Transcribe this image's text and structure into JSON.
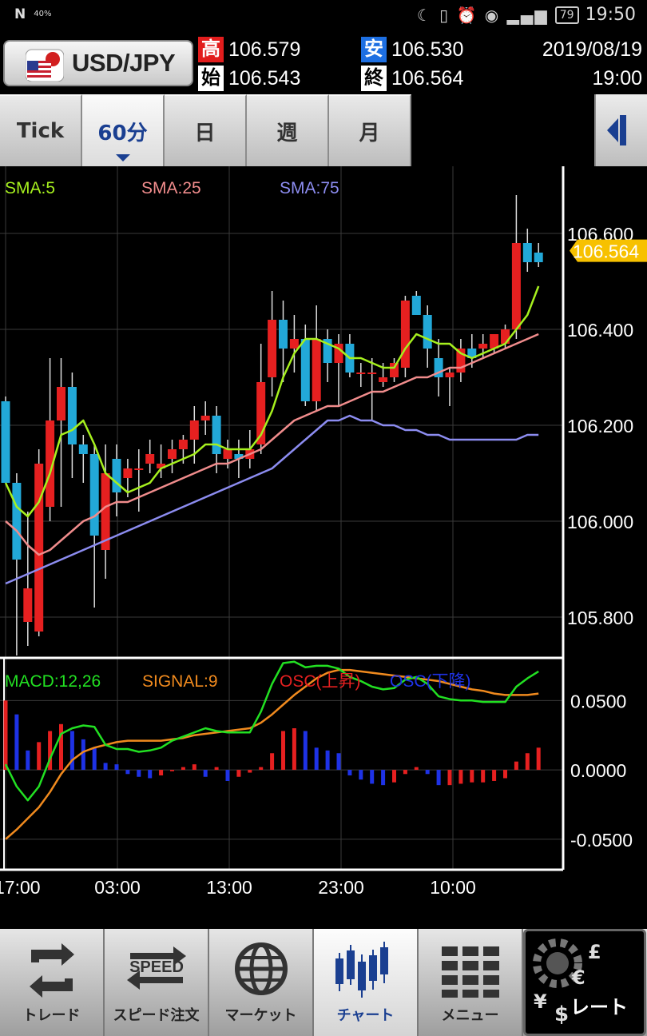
{
  "status_bar": {
    "nfc": "N",
    "signal_pct": "40%",
    "icons": "☾ ▯ ⏰ ◉ ▂▄▆",
    "battery": "79",
    "time": "19:50"
  },
  "header": {
    "pair": "USD/JPY",
    "high_badge": "高",
    "high_value": "106.579",
    "low_badge": "安",
    "low_value": "106.530",
    "open_badge": "始",
    "open_value": "106.543",
    "close_badge": "終",
    "close_value": "106.564",
    "date": "2019/08/19",
    "time": "19:00"
  },
  "tabs": [
    {
      "label": "Tick",
      "active": false
    },
    {
      "label": "60分",
      "active": true
    },
    {
      "label": "日",
      "active": false
    },
    {
      "label": "週",
      "active": false
    },
    {
      "label": "月",
      "active": false
    }
  ],
  "colors": {
    "up": "#e62020",
    "down": "#22a8d8",
    "sma5": "#a6f01e",
    "sma25": "#f08c8c",
    "sma75": "#8c8cf0",
    "macd": "#22e022",
    "signal": "#f08a1e",
    "osc_up": "#e62020",
    "osc_down": "#1e32e6",
    "current_price": "#f7c100"
  },
  "chart_data": [
    {
      "type": "candlestick",
      "legend": [
        "SMA:5",
        "SMA:25",
        "SMA:75"
      ],
      "y_ticks": [
        "106.600",
        "106.400",
        "106.200",
        "106.000",
        "105.800"
      ],
      "ylim": [
        105.72,
        106.74
      ],
      "current_price": "106.564",
      "candles": [
        {
          "o": 106.25,
          "h": 106.26,
          "l": 106.12,
          "c": 106.08
        },
        {
          "o": 106.08,
          "h": 106.1,
          "l": 105.72,
          "c": 105.92
        },
        {
          "o": 105.79,
          "h": 106.02,
          "l": 105.74,
          "c": 105.86
        },
        {
          "o": 105.77,
          "h": 106.15,
          "l": 105.76,
          "c": 106.12
        },
        {
          "o": 106.03,
          "h": 106.34,
          "l": 106.0,
          "c": 106.21
        },
        {
          "o": 106.21,
          "h": 106.34,
          "l": 106.03,
          "c": 106.28
        },
        {
          "o": 106.28,
          "h": 106.31,
          "l": 106.09,
          "c": 106.16
        },
        {
          "o": 106.16,
          "h": 106.18,
          "l": 106.08,
          "c": 106.14
        },
        {
          "o": 106.14,
          "h": 106.16,
          "l": 105.82,
          "c": 105.97
        },
        {
          "o": 105.94,
          "h": 106.16,
          "l": 105.88,
          "c": 106.1
        },
        {
          "o": 106.13,
          "h": 106.16,
          "l": 106.01,
          "c": 106.06
        },
        {
          "o": 106.09,
          "h": 106.13,
          "l": 106.05,
          "c": 106.11
        },
        {
          "o": 106.11,
          "h": 106.15,
          "l": 106.02,
          "c": 106.11
        },
        {
          "o": 106.12,
          "h": 106.17,
          "l": 106.1,
          "c": 106.14
        },
        {
          "o": 106.11,
          "h": 106.16,
          "l": 106.09,
          "c": 106.12
        },
        {
          "o": 106.13,
          "h": 106.17,
          "l": 106.1,
          "c": 106.15
        },
        {
          "o": 106.15,
          "h": 106.18,
          "l": 106.12,
          "c": 106.17
        },
        {
          "o": 106.17,
          "h": 106.24,
          "l": 106.12,
          "c": 106.21
        },
        {
          "o": 106.21,
          "h": 106.25,
          "l": 106.18,
          "c": 106.22
        },
        {
          "o": 106.22,
          "h": 106.24,
          "l": 106.1,
          "c": 106.14
        },
        {
          "o": 106.13,
          "h": 106.17,
          "l": 106.11,
          "c": 106.15
        },
        {
          "o": 106.14,
          "h": 106.17,
          "l": 106.09,
          "c": 106.13
        },
        {
          "o": 106.13,
          "h": 106.19,
          "l": 106.11,
          "c": 106.15
        },
        {
          "o": 106.16,
          "h": 106.37,
          "l": 106.14,
          "c": 106.29
        },
        {
          "o": 106.3,
          "h": 106.48,
          "l": 106.26,
          "c": 106.42
        },
        {
          "o": 106.42,
          "h": 106.46,
          "l": 106.29,
          "c": 106.36
        },
        {
          "o": 106.36,
          "h": 106.43,
          "l": 106.31,
          "c": 106.38
        },
        {
          "o": 106.38,
          "h": 106.41,
          "l": 106.24,
          "c": 106.25
        },
        {
          "o": 106.25,
          "h": 106.45,
          "l": 106.23,
          "c": 106.38
        },
        {
          "o": 106.38,
          "h": 106.4,
          "l": 106.29,
          "c": 106.33
        },
        {
          "o": 106.33,
          "h": 106.39,
          "l": 106.24,
          "c": 106.37
        },
        {
          "o": 106.37,
          "h": 106.39,
          "l": 106.3,
          "c": 106.31
        },
        {
          "o": 106.31,
          "h": 106.33,
          "l": 106.28,
          "c": 106.31
        },
        {
          "o": 106.31,
          "h": 106.34,
          "l": 106.21,
          "c": 106.31
        },
        {
          "o": 106.29,
          "h": 106.33,
          "l": 106.28,
          "c": 106.3
        },
        {
          "o": 106.3,
          "h": 106.34,
          "l": 106.29,
          "c": 106.33
        },
        {
          "o": 106.32,
          "h": 106.47,
          "l": 106.3,
          "c": 106.46
        },
        {
          "o": 106.47,
          "h": 106.48,
          "l": 106.43,
          "c": 106.43
        },
        {
          "o": 106.43,
          "h": 106.45,
          "l": 106.32,
          "c": 106.36
        },
        {
          "o": 106.34,
          "h": 106.38,
          "l": 106.26,
          "c": 106.3
        },
        {
          "o": 106.3,
          "h": 106.32,
          "l": 106.24,
          "c": 106.31
        },
        {
          "o": 106.31,
          "h": 106.38,
          "l": 106.29,
          "c": 106.36
        },
        {
          "o": 106.36,
          "h": 106.39,
          "l": 106.32,
          "c": 106.34
        },
        {
          "o": 106.36,
          "h": 106.39,
          "l": 106.34,
          "c": 106.37
        },
        {
          "o": 106.36,
          "h": 106.39,
          "l": 106.35,
          "c": 106.39
        },
        {
          "o": 106.37,
          "h": 106.41,
          "l": 106.36,
          "c": 106.4
        },
        {
          "o": 106.4,
          "h": 106.68,
          "l": 106.38,
          "c": 106.58
        },
        {
          "o": 106.58,
          "h": 106.61,
          "l": 106.52,
          "c": 106.54
        },
        {
          "o": 106.56,
          "h": 106.58,
          "l": 106.53,
          "c": 106.54
        }
      ],
      "sma5": [
        106.08,
        106.03,
        106.01,
        106.04,
        106.1,
        106.18,
        106.19,
        106.21,
        106.16,
        106.1,
        106.08,
        106.06,
        106.07,
        106.08,
        106.11,
        106.12,
        106.13,
        106.14,
        106.16,
        106.16,
        106.15,
        106.15,
        106.15,
        106.18,
        106.23,
        106.3,
        106.35,
        106.38,
        106.38,
        106.37,
        106.36,
        106.34,
        106.34,
        106.33,
        106.32,
        106.32,
        106.36,
        106.39,
        106.38,
        106.37,
        106.37,
        106.35,
        106.34,
        106.35,
        106.36,
        106.37,
        106.4,
        106.43,
        106.49
      ],
      "sma25": [
        106.0,
        105.98,
        105.95,
        105.93,
        105.94,
        105.96,
        105.98,
        106.0,
        106.01,
        106.03,
        106.04,
        106.04,
        106.05,
        106.06,
        106.07,
        106.08,
        106.09,
        106.1,
        106.11,
        106.12,
        106.12,
        106.13,
        106.14,
        106.15,
        106.17,
        106.19,
        106.21,
        106.22,
        106.23,
        106.24,
        106.24,
        106.25,
        106.26,
        106.27,
        106.27,
        106.28,
        106.29,
        106.3,
        106.3,
        106.31,
        106.32,
        106.32,
        106.33,
        106.34,
        106.35,
        106.36,
        106.37,
        106.38,
        106.39
      ],
      "sma75": [
        105.87,
        105.88,
        105.89,
        105.9,
        105.91,
        105.92,
        105.93,
        105.94,
        105.95,
        105.96,
        105.97,
        105.98,
        105.99,
        106.0,
        106.01,
        106.02,
        106.03,
        106.04,
        106.05,
        106.06,
        106.07,
        106.08,
        106.09,
        106.1,
        106.11,
        106.13,
        106.15,
        106.17,
        106.19,
        106.21,
        106.21,
        106.22,
        106.21,
        106.21,
        106.2,
        106.2,
        106.19,
        106.19,
        106.18,
        106.18,
        106.17,
        106.17,
        106.17,
        106.17,
        106.17,
        106.17,
        106.17,
        106.18,
        106.18
      ]
    },
    {
      "type": "macd",
      "legend": [
        "MACD:12,26",
        "SIGNAL:9",
        "OSC(上昇)",
        "OSC(下降)"
      ],
      "y_ticks": [
        "0.0500",
        "0.0000",
        "-0.0500"
      ],
      "ylim": [
        -0.072,
        0.079
      ],
      "x_labels": [
        "17:00",
        "03:00",
        "13:00",
        "23:00",
        "10:00"
      ],
      "macd": [
        0.004,
        -0.012,
        -0.022,
        -0.012,
        0.008,
        0.026,
        0.03,
        0.032,
        0.031,
        0.018,
        0.015,
        0.015,
        0.013,
        0.014,
        0.016,
        0.021,
        0.024,
        0.027,
        0.03,
        0.028,
        0.027,
        0.027,
        0.027,
        0.042,
        0.062,
        0.077,
        0.078,
        0.074,
        0.075,
        0.075,
        0.073,
        0.067,
        0.064,
        0.06,
        0.058,
        0.059,
        0.065,
        0.067,
        0.062,
        0.053,
        0.051,
        0.05,
        0.05,
        0.049,
        0.049,
        0.049,
        0.06,
        0.066,
        0.071
      ],
      "signal": [
        -0.05,
        -0.043,
        -0.035,
        -0.027,
        -0.016,
        -0.003,
        0.007,
        0.013,
        0.016,
        0.018,
        0.02,
        0.021,
        0.021,
        0.021,
        0.021,
        0.022,
        0.023,
        0.025,
        0.026,
        0.027,
        0.028,
        0.029,
        0.03,
        0.034,
        0.04,
        0.047,
        0.054,
        0.06,
        0.066,
        0.07,
        0.072,
        0.072,
        0.071,
        0.07,
        0.069,
        0.068,
        0.067,
        0.066,
        0.065,
        0.064,
        0.062,
        0.06,
        0.058,
        0.057,
        0.055,
        0.054,
        0.054,
        0.054,
        0.055
      ],
      "osc": [
        0.05,
        0.04,
        0.014,
        0.02,
        0.028,
        0.033,
        0.028,
        0.022,
        0.016,
        0.005,
        0.004,
        -0.003,
        -0.005,
        -0.006,
        -0.004,
        -0.001,
        0.002,
        0.004,
        -0.005,
        0.002,
        -0.008,
        -0.005,
        -0.002,
        0.002,
        0.012,
        0.028,
        0.03,
        0.028,
        0.016,
        0.014,
        0.012,
        -0.004,
        -0.007,
        -0.01,
        -0.011,
        -0.009,
        -0.003,
        0.002,
        -0.003,
        -0.011,
        -0.011,
        -0.01,
        -0.009,
        -0.009,
        -0.008,
        -0.006,
        0.006,
        0.012,
        0.016
      ]
    }
  ],
  "bottom_nav": [
    {
      "label": "トレード",
      "icon": "trade-icon",
      "active": false
    },
    {
      "label": "スピード注文",
      "icon": "speed-order-icon",
      "speed_text": "SPEED",
      "active": false
    },
    {
      "label": "マーケット",
      "icon": "market-globe-icon",
      "active": false
    },
    {
      "label": "チャート",
      "icon": "chart-icon",
      "active": true
    },
    {
      "label": "メニュー",
      "icon": "menu-grid-icon",
      "active": false
    }
  ],
  "rate_button": {
    "label": "レート",
    "symbols": [
      "£",
      "€",
      "¥",
      "$"
    ]
  }
}
